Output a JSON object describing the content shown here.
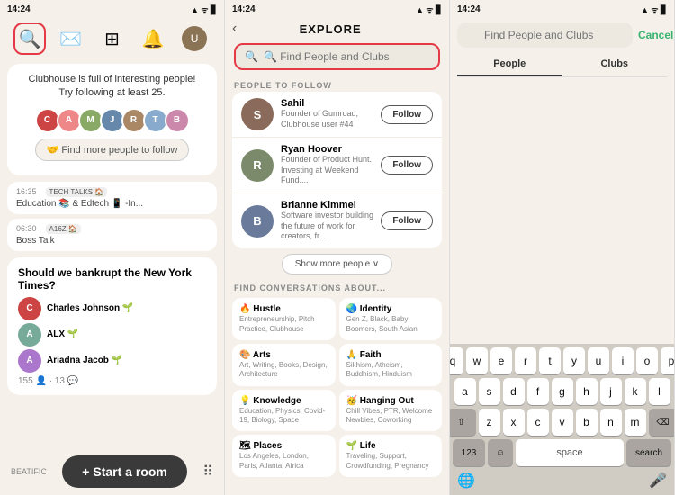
{
  "panel1": {
    "status": {
      "time": "14:24",
      "icons": "▲ ᯤ ▊"
    },
    "nav": [
      {
        "id": "search",
        "icon": "🔍",
        "active": true
      },
      {
        "id": "envelope",
        "icon": "✉️"
      },
      {
        "id": "calendar",
        "icon": "⊞"
      },
      {
        "id": "bell",
        "icon": "🔔"
      },
      {
        "id": "avatar",
        "icon": "👤"
      }
    ],
    "banner": {
      "line1": "Clubhouse is full of interesting people!",
      "line2": "Try following at least 25."
    },
    "follow_btn": "🤝 Find more people to follow",
    "talks": [
      {
        "time": "16:35",
        "tag": "TECH TALKS 🏠",
        "title": "Education 📚 & Edtech 📱 -In..."
      },
      {
        "time": "06:30",
        "tag": "A16Z 🏠",
        "title": "Boss Talk"
      }
    ],
    "card": {
      "title": "Should we bankrupt the New York Times?",
      "people": [
        {
          "name": "Charles Johnson 🌱",
          "color": "#c44"
        },
        {
          "name": "ALX 🌱",
          "color": "#7a9"
        },
        {
          "name": "Ariadna Jacob 🌱",
          "color": "#a7c"
        }
      ],
      "stats": "155 👤 · 13 💬"
    },
    "footer": {
      "label": "BEATIFIC",
      "start_room": "+ Start a room"
    }
  },
  "panel2": {
    "status": {
      "time": "14:24",
      "icons": "▲ ᯤ ▊"
    },
    "header": "EXPLORE",
    "search_placeholder": "🔍 Find People and Clubs",
    "people_section": "PEOPLE TO FOLLOW",
    "people": [
      {
        "name": "Sahil",
        "desc": "Founder of Gumroad, Clubhouse user #44",
        "color": "#8a6a5a",
        "initial": "S",
        "follow": "Follow"
      },
      {
        "name": "Ryan Hoover",
        "desc": "Founder of Product Hunt. Investing at Weekend Fund....",
        "color": "#7a8a6a",
        "initial": "R",
        "follow": "Follow"
      },
      {
        "name": "Brianne Kimmel",
        "desc": "Software investor building the future of work for creators, fr...",
        "color": "#6a7a9a",
        "initial": "B",
        "follow": "Follow"
      }
    ],
    "show_more": "Show more people ∨",
    "conversations_section": "FIND CONVERSATIONS ABOUT...",
    "topics": [
      {
        "emoji": "🔥",
        "title": "Hustle",
        "sub": "Entrepreneurship, Pitch Practice, Clubhouse"
      },
      {
        "emoji": "🌏",
        "title": "Identity",
        "sub": "Gen Z, Black, Baby Boomers, South Asian"
      },
      {
        "emoji": "🎨",
        "title": "Arts",
        "sub": "Art, Writing, Books, Design, Architecture"
      },
      {
        "emoji": "🙏",
        "title": "Faith",
        "sub": "Sikhism, Atheism, Buddhism, Hinduism"
      },
      {
        "emoji": "💡",
        "title": "Knowledge",
        "sub": "Education, Physics, Covid-19, Biology, Space"
      },
      {
        "emoji": "🥳",
        "title": "Hanging Out",
        "sub": "Chill Vibes, PTR, Welcome Newbies, Coworking"
      },
      {
        "emoji": "🗺",
        "title": "Places",
        "sub": "Los Angeles, London, Paris, Atlanta, Africa"
      },
      {
        "emoji": "🌱",
        "title": "Life",
        "sub": "Traveling, Support, Crowdfunding, Pregnancy"
      }
    ]
  },
  "panel3": {
    "status": {
      "time": "14:24",
      "icons": "▲ ᯤ ▊"
    },
    "search_placeholder": "Find People and Clubs",
    "cancel": "Cancel",
    "tabs": [
      "People",
      "Clubs"
    ],
    "active_tab": 0,
    "keyboard": {
      "rows": [
        [
          "q",
          "w",
          "e",
          "r",
          "t",
          "y",
          "u",
          "i",
          "o",
          "p"
        ],
        [
          "a",
          "s",
          "d",
          "f",
          "g",
          "h",
          "j",
          "k",
          "l"
        ],
        [
          "⇧",
          "z",
          "x",
          "c",
          "v",
          "b",
          "n",
          "m",
          "⌫"
        ]
      ],
      "bottom": [
        "123",
        "☺",
        "space",
        "🌐",
        "🎤"
      ],
      "space_label": "space",
      "search_label": "search"
    }
  }
}
